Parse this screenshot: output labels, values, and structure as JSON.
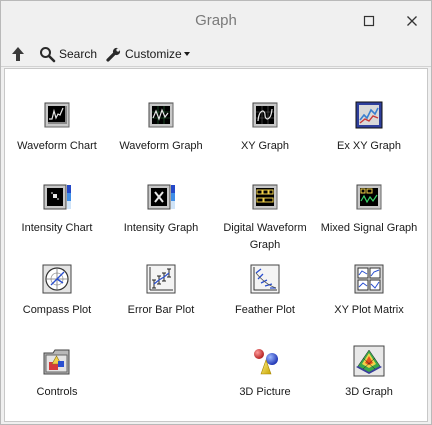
{
  "window": {
    "title": "Graph"
  },
  "toolbar": {
    "search_label": "Search",
    "customize_label": "Customize"
  },
  "palette": {
    "items": [
      {
        "label": "Waveform Chart"
      },
      {
        "label": "Waveform Graph"
      },
      {
        "label": "XY Graph"
      },
      {
        "label": "Ex XY Graph"
      },
      {
        "label": "Intensity Chart"
      },
      {
        "label": "Intensity Graph"
      },
      {
        "label": "Digital Waveform Graph"
      },
      {
        "label": "Mixed Signal Graph"
      },
      {
        "label": "Compass Plot"
      },
      {
        "label": "Error Bar Plot"
      },
      {
        "label": "Feather Plot"
      },
      {
        "label": "XY Plot Matrix"
      },
      {
        "label": "Controls"
      },
      {
        "label": "3D Picture"
      },
      {
        "label": "3D Graph"
      }
    ]
  }
}
